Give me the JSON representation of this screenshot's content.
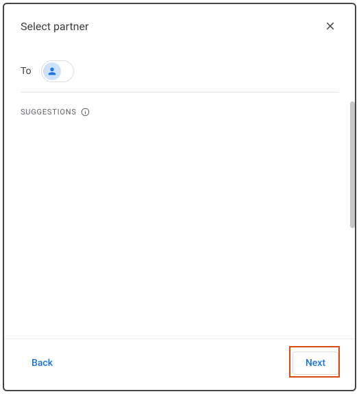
{
  "header": {
    "title": "Select partner"
  },
  "to": {
    "label": "To",
    "input_value": ""
  },
  "suggestions": {
    "label": "SUGGESTIONS"
  },
  "footer": {
    "back_label": "Back",
    "next_label": "Next"
  }
}
